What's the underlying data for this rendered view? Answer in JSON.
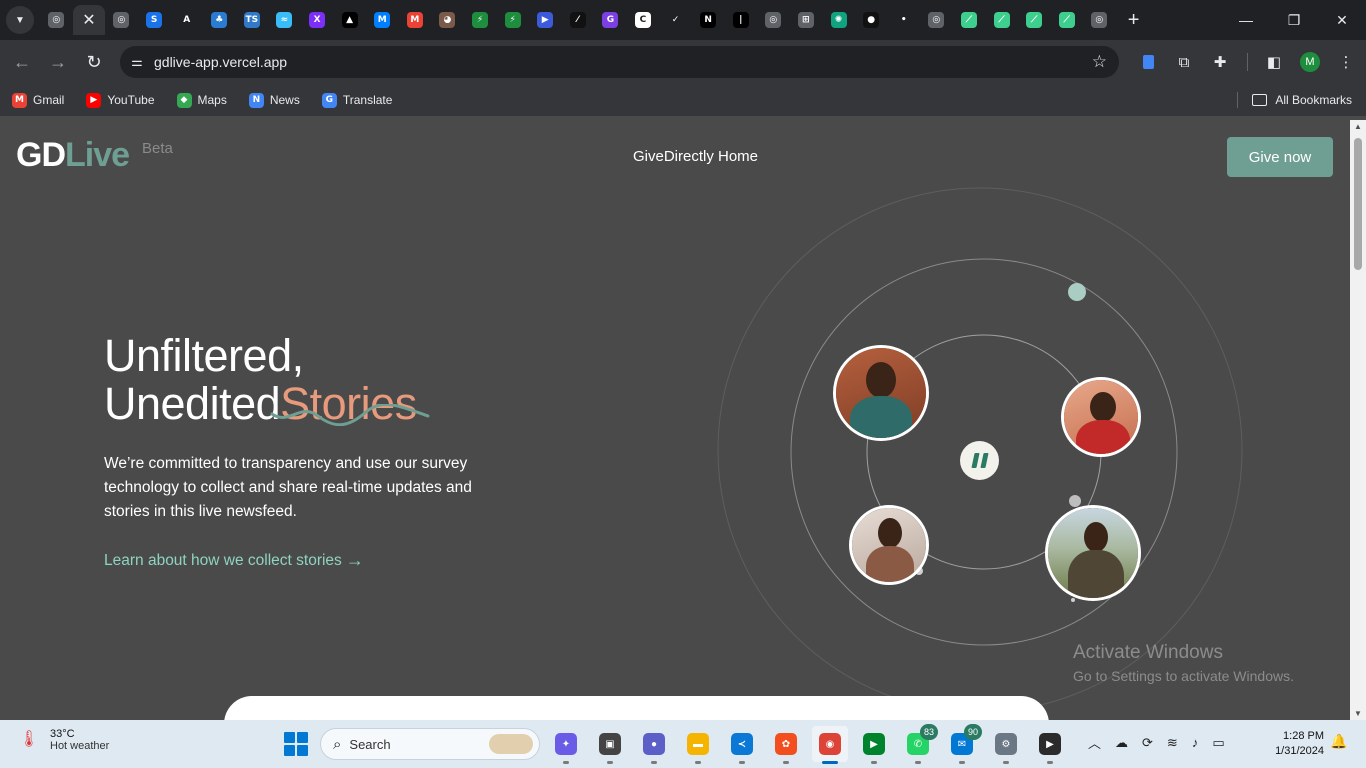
{
  "browser": {
    "tabs": [
      {
        "icon": "chrome-icon",
        "color": "#5f6368",
        "glyph": "◎"
      },
      {
        "icon": "github-icon",
        "color": "#24292f",
        "glyph": "●",
        "active": true,
        "close_glyph": "✕"
      },
      {
        "icon": "globe-icon",
        "color": "#5f6368",
        "glyph": "◎"
      },
      {
        "icon": "shazam-icon",
        "color": "#1a73e8",
        "glyph": "S"
      },
      {
        "icon": "astro-icon",
        "color": "#202124",
        "glyph": "A"
      },
      {
        "icon": "devops-icon",
        "color": "#2a7bd2",
        "glyph": "♣"
      },
      {
        "icon": "typescript-icon",
        "color": "#3178c6",
        "glyph": "TS"
      },
      {
        "icon": "tailwind-icon",
        "color": "#38bdf8",
        "glyph": "≈"
      },
      {
        "icon": "xd-icon",
        "color": "#7b2ff7",
        "glyph": "X"
      },
      {
        "icon": "vercel-icon",
        "color": "#000000",
        "glyph": "▲"
      },
      {
        "icon": "material-icon",
        "color": "#007fff",
        "glyph": "M"
      },
      {
        "icon": "gmail-icon",
        "color": "#ea4335",
        "glyph": "M"
      },
      {
        "icon": "cat-icon",
        "color": "#7a5a48",
        "glyph": "◕"
      },
      {
        "icon": "activity-icon",
        "color": "#1e8e3e",
        "glyph": "⚡"
      },
      {
        "icon": "activity-icon",
        "color": "#1e8e3e",
        "glyph": "⚡"
      },
      {
        "icon": "play-icon",
        "color": "#3b5bdb",
        "glyph": "▶"
      },
      {
        "icon": "slash-icon",
        "color": "#111111",
        "glyph": "⁄"
      },
      {
        "icon": "circle-g-icon",
        "color": "#7b3fe4",
        "glyph": "G"
      },
      {
        "icon": "circle-c-icon",
        "color": "#ffffff",
        "glyph": "C"
      },
      {
        "icon": "check-circle-icon",
        "color": "#202124",
        "glyph": "✓"
      },
      {
        "icon": "notion-icon",
        "color": "#000000",
        "glyph": "N"
      },
      {
        "icon": "bar-icon",
        "color": "#000000",
        "glyph": "|"
      },
      {
        "icon": "globe-icon",
        "color": "#5f6368",
        "glyph": "◎"
      },
      {
        "icon": "web-icon",
        "color": "#5f6368",
        "glyph": "⊞"
      },
      {
        "icon": "openai-icon",
        "color": "#10a37f",
        "glyph": "✺"
      },
      {
        "icon": "circle-dark-icon",
        "color": "#111111",
        "glyph": "●"
      },
      {
        "icon": "dot-icon",
        "color": "#202124",
        "glyph": "•"
      },
      {
        "icon": "globe-icon",
        "color": "#5f6368",
        "glyph": "◎"
      },
      {
        "icon": "supabase-icon",
        "color": "#3ecf8e",
        "glyph": "⟋"
      },
      {
        "icon": "supabase-icon",
        "color": "#3ecf8e",
        "glyph": "⟋"
      },
      {
        "icon": "supabase-icon",
        "color": "#3ecf8e",
        "glyph": "⟋"
      },
      {
        "icon": "supabase-icon",
        "color": "#3ecf8e",
        "glyph": "⟋"
      },
      {
        "icon": "chrome-icon",
        "color": "#5f6368",
        "glyph": "◎"
      }
    ],
    "new_tab_glyph": "+",
    "url": "gdlive-app.vercel.app",
    "bookmarks": [
      {
        "label": "Gmail",
        "icon": "gmail-icon",
        "color": "#ea4335",
        "glyph": "M"
      },
      {
        "label": "YouTube",
        "icon": "youtube-icon",
        "color": "#ff0000",
        "glyph": "▶"
      },
      {
        "label": "Maps",
        "icon": "maps-icon",
        "color": "#34a853",
        "glyph": "◆"
      },
      {
        "label": "News",
        "icon": "news-icon",
        "color": "#4285f4",
        "glyph": "N"
      },
      {
        "label": "Translate",
        "icon": "translate-icon",
        "color": "#4285f4",
        "glyph": "G"
      }
    ],
    "all_bookmarks": "All Bookmarks",
    "profile_initial": "M"
  },
  "page": {
    "logo": {
      "gd": "GD",
      "live": "Live",
      "beta": "Beta"
    },
    "nav_home": "GiveDirectly Home",
    "give_now": "Give now",
    "headline_line1": "Unfiltered,",
    "headline_line2": "Unedited",
    "headline_accent": "Stories",
    "intro": "We’re committed to transparency and use our survey technology to collect and share real-time updates and stories in this live newsfeed.",
    "learn_link": "Learn about how we collect stories",
    "colors": {
      "accent_green": "#6f9e92",
      "accent_salmon": "#e89a7c",
      "link_mint": "#8fd3c0"
    }
  },
  "watermark": {
    "title": "Activate Windows",
    "subtitle": "Go to Settings to activate Windows."
  },
  "taskbar": {
    "weather_temp": "33°C",
    "weather_desc": "Hot weather",
    "search_placeholder": "Search",
    "apps": [
      {
        "icon": "copilot-icon",
        "color": "#6b5ce7",
        "glyph": "✦"
      },
      {
        "icon": "task-view-icon",
        "color": "#444444",
        "glyph": "▣"
      },
      {
        "icon": "teams-icon",
        "color": "#5b5fc7",
        "glyph": "●"
      },
      {
        "icon": "file-explorer-icon",
        "color": "#f4b400",
        "glyph": "▬"
      },
      {
        "icon": "vscode-icon",
        "color": "#0a78d4",
        "glyph": "≺"
      },
      {
        "icon": "figma-icon",
        "color": "#f24e1e",
        "glyph": "✿"
      },
      {
        "icon": "chrome-icon",
        "color": "#db4437",
        "glyph": "◉",
        "active": true
      },
      {
        "icon": "meet-icon",
        "color": "#00832d",
        "glyph": "▶"
      },
      {
        "icon": "whatsapp-icon",
        "color": "#25d366",
        "glyph": "✆",
        "badge": "83"
      },
      {
        "icon": "messages-icon",
        "color": "#0078d4",
        "glyph": "✉",
        "badge": "90"
      },
      {
        "icon": "settings-icon",
        "color": "#6b7785",
        "glyph": "⚙"
      },
      {
        "icon": "media-player-icon",
        "color": "#2b2b2b",
        "glyph": "▶"
      }
    ],
    "time": "1:28 PM",
    "date": "1/31/2024"
  }
}
